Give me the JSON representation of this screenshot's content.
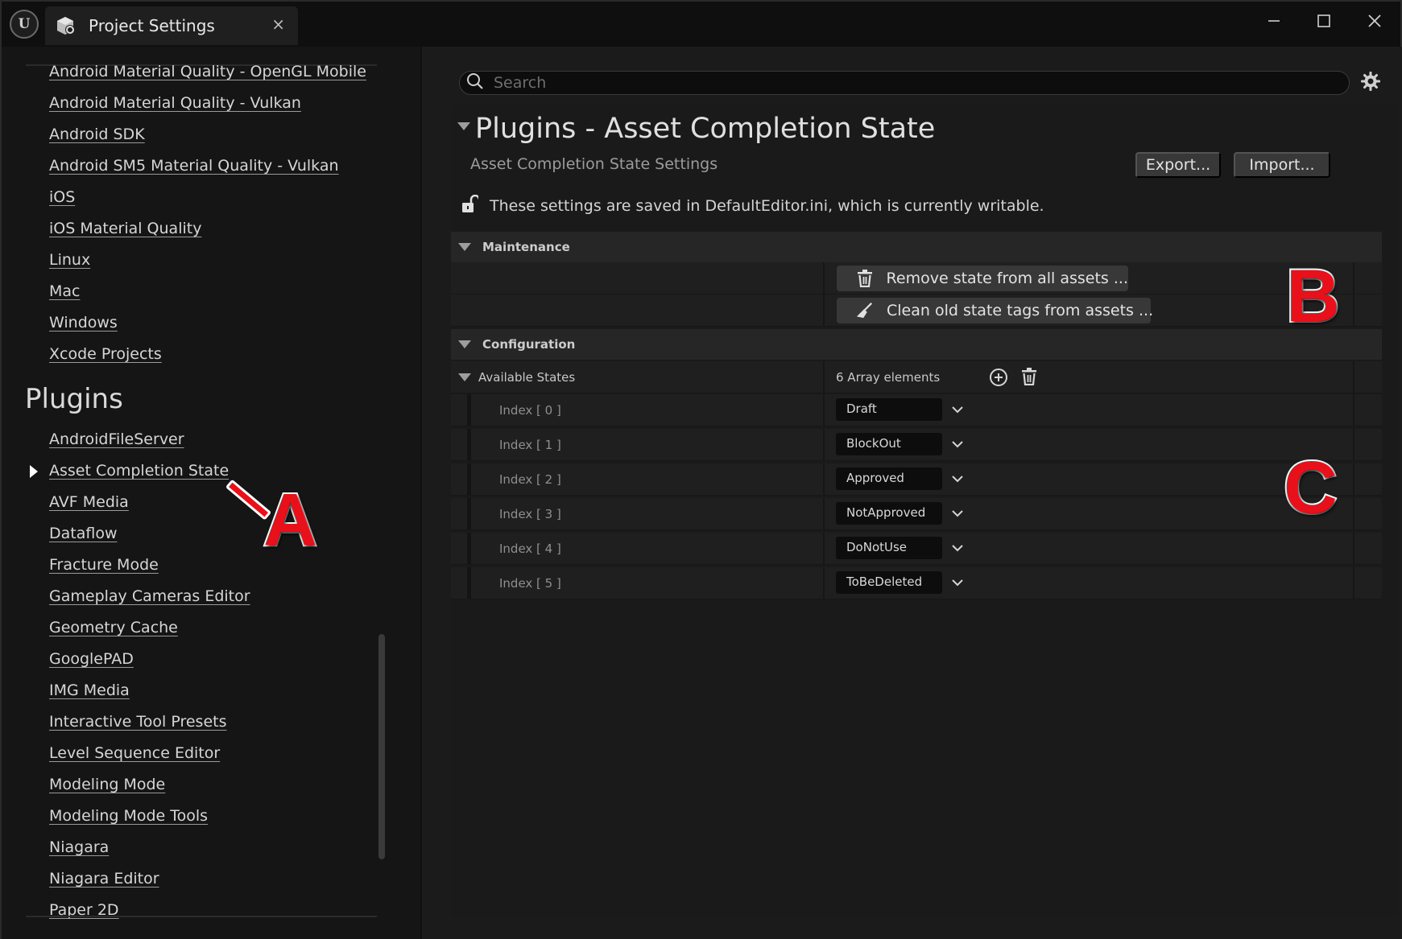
{
  "titlebar": {
    "tab_title": "Project Settings",
    "close_glyph": "×",
    "minimize_glyph": "—",
    "maximize_glyph": "☐",
    "window_close_glyph": "✕"
  },
  "sidebar": {
    "platform_items": [
      "Android Material Quality - OpenGL Mobile",
      "Android Material Quality - Vulkan",
      "Android SDK",
      "Android SM5 Material Quality - Vulkan",
      "iOS",
      "iOS Material Quality",
      "Linux",
      "Mac",
      "Windows",
      "Xcode Projects"
    ],
    "plugins_heading": "Plugins",
    "plugin_items": [
      "AndroidFileServer",
      "Asset Completion State",
      "AVF Media",
      "Dataflow",
      "Fracture Mode",
      "Gameplay Cameras Editor",
      "Geometry Cache",
      "GooglePAD",
      "IMG Media",
      "Interactive Tool Presets",
      "Level Sequence Editor",
      "Modeling Mode",
      "Modeling Mode Tools",
      "Niagara",
      "Niagara Editor",
      "Paper 2D"
    ],
    "selected_item": "Asset Completion State"
  },
  "main": {
    "search_placeholder": "Search",
    "title": "Plugins - Asset Completion State",
    "subtitle": "Asset Completion State Settings",
    "export_label": "Export...",
    "import_label": "Import...",
    "notice": "These settings are saved in DefaultEditor.ini, which is currently writable.",
    "maintenance": {
      "label": "Maintenance",
      "remove_button": "Remove state from all assets ...",
      "clean_button": "Clean old state tags from assets ..."
    },
    "configuration": {
      "label": "Configuration",
      "available_states_label": "Available States",
      "array_count": "6 Array elements",
      "elements": [
        {
          "index": "Index [ 0 ]",
          "value": "Draft"
        },
        {
          "index": "Index [ 1 ]",
          "value": "BlockOut"
        },
        {
          "index": "Index [ 2 ]",
          "value": "Approved"
        },
        {
          "index": "Index [ 3 ]",
          "value": "NotApproved"
        },
        {
          "index": "Index [ 4 ]",
          "value": "DoNotUse"
        },
        {
          "index": "Index [ 5 ]",
          "value": "ToBeDeleted"
        }
      ]
    }
  },
  "annotations": {
    "a": "A",
    "b": "B",
    "c": "C"
  },
  "colors": {
    "annotation_red": "#e8101a",
    "background": "#151515",
    "panel": "#1b1b1b",
    "category_row": "#262626"
  }
}
